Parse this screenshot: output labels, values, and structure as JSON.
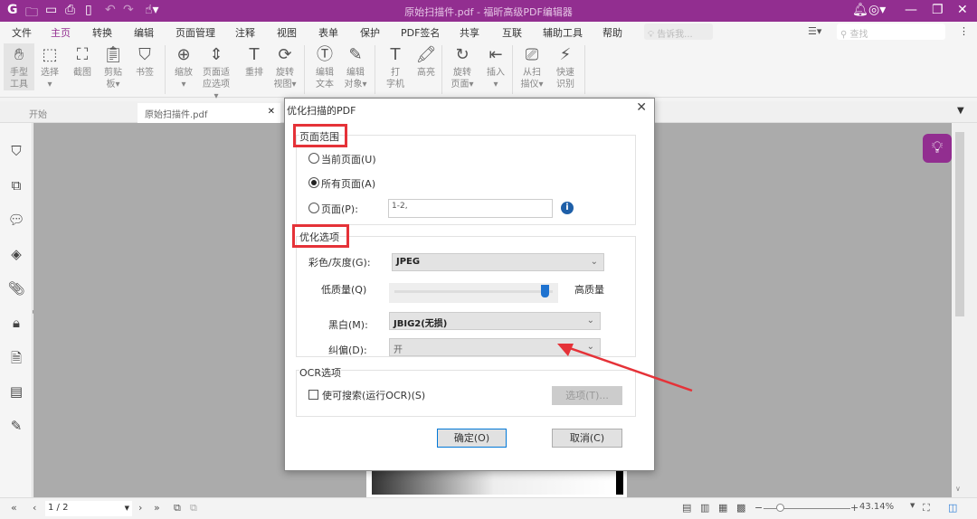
{
  "titlebar": {
    "title": "原始扫描件.pdf - 福昕高级PDF编辑器"
  },
  "menu": [
    "文件",
    "主页",
    "转换",
    "编辑",
    "页面管理",
    "注释",
    "视图",
    "表单",
    "保护",
    "PDF签名",
    "共享",
    "互联",
    "辅助工具",
    "帮助"
  ],
  "tell_me_placeholder": "告诉我...",
  "search_placeholder": "查找",
  "ribbon": [
    {
      "l1": "手型",
      "l2": "工具",
      "icon": "hand"
    },
    {
      "l1": "选择",
      "l2": "▾",
      "icon": "select"
    },
    {
      "l1": "截图",
      "l2": "",
      "icon": "snapshot"
    },
    {
      "l1": "剪贴",
      "l2": "板▾",
      "icon": "clipboard"
    },
    {
      "l1": "书签",
      "l2": "",
      "icon": "bookmark"
    },
    {
      "l1": "缩放",
      "l2": "▾",
      "icon": "zoom"
    },
    {
      "l1": "页面适",
      "l2": "应选项▾",
      "icon": "fit-page"
    },
    {
      "l1": "重排",
      "l2": "",
      "icon": "reflow"
    },
    {
      "l1": "旋转",
      "l2": "视图▾",
      "icon": "rotate-view"
    },
    {
      "l1": "编辑",
      "l2": "文本",
      "icon": "edit-text"
    },
    {
      "l1": "编辑",
      "l2": "对象▾",
      "icon": "edit-object"
    },
    {
      "l1": "打",
      "l2": "字机",
      "icon": "typewriter"
    },
    {
      "l1": "高亮",
      "l2": "",
      "icon": "highlight"
    },
    {
      "l1": "旋转",
      "l2": "页面▾",
      "icon": "rotate-page"
    },
    {
      "l1": "插入",
      "l2": "▾",
      "icon": "insert"
    },
    {
      "l1": "从扫",
      "l2": "描仪▾",
      "icon": "scanner"
    },
    {
      "l1": "快速",
      "l2": "识别",
      "icon": "ocr"
    }
  ],
  "tabs": [
    {
      "label": "开始"
    },
    {
      "label": "原始扫描件.pdf"
    }
  ],
  "dialog": {
    "title": "优化扫描的PDF",
    "page_range": {
      "title": "页面范围",
      "current": "当前页面(U)",
      "all": "所有页面(A)",
      "pages": "页面(P):",
      "pages_value": "1-2,",
      "selected": "all"
    },
    "optimize": {
      "title": "优化选项",
      "color_label": "彩色/灰度(G):",
      "color_value": "JPEG",
      "low": "低质量(Q)",
      "high": "高质量",
      "quality": 0.95,
      "bw_label": "黑白(M):",
      "bw_value": "JBIG2(无损)",
      "deskew_label": "纠偏(D):",
      "deskew_value": "开"
    },
    "ocr": {
      "title": "OCR选项",
      "searchable": "使可搜索(运行OCR)(S)",
      "options_btn": "选项(T)..."
    },
    "ok": "确定(O)",
    "cancel": "取消(C)"
  },
  "status": {
    "page": "1 / 2",
    "zoom": "43.14%"
  }
}
